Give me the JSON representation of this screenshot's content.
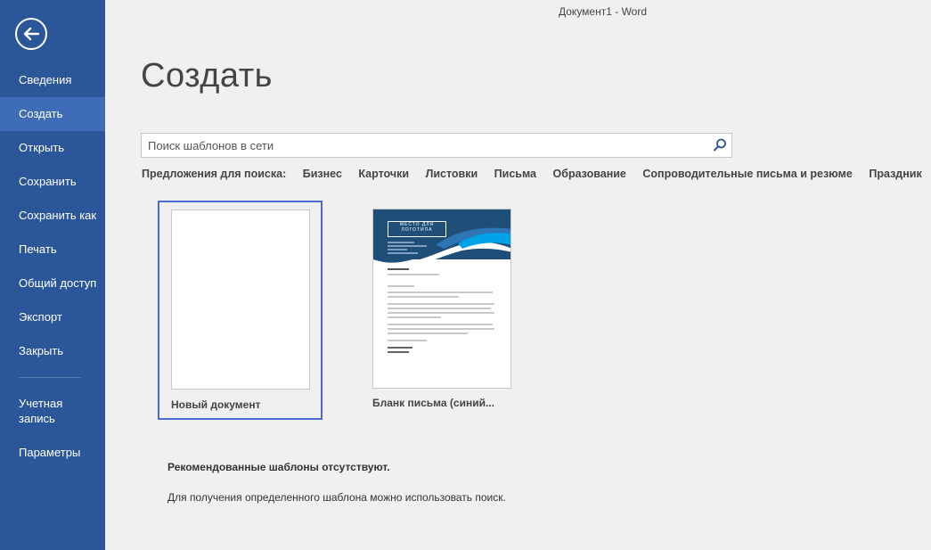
{
  "window": {
    "title": "Документ1 - Word"
  },
  "sidebar": {
    "back_icon": "back-arrow-icon",
    "bg_color": "#2b579a",
    "active_color": "#3f6cb7",
    "items": [
      {
        "label": "Сведения"
      },
      {
        "label": "Создать",
        "active": true
      },
      {
        "label": "Открыть"
      },
      {
        "label": "Сохранить"
      },
      {
        "label": "Сохранить как"
      },
      {
        "label": "Печать"
      },
      {
        "label": "Общий доступ"
      },
      {
        "label": "Экспорт"
      },
      {
        "label": "Закрыть"
      },
      {
        "label": "Учетная запись"
      },
      {
        "label": "Параметры"
      }
    ]
  },
  "main": {
    "title": "Создать",
    "search": {
      "placeholder": "Поиск шаблонов в сети",
      "value": "",
      "icon": "search-icon"
    },
    "suggestions": {
      "label": "Предложения для поиска:",
      "items": [
        "Бизнес",
        "Карточки",
        "Листовки",
        "Письма",
        "Образование",
        "Сопроводительные письма и резюме",
        "Праздник"
      ]
    },
    "templates": [
      {
        "label": "Новый документ",
        "selected": true
      },
      {
        "label": "Бланк письма (синий...",
        "logo_text": "МЕСТО ДЛЯ ЛОГОТИПА"
      }
    ],
    "notice": {
      "title": "Рекомендованные шаблоны отсутствуют.",
      "text": "Для получения определенного шаблона можно использовать поиск."
    }
  }
}
